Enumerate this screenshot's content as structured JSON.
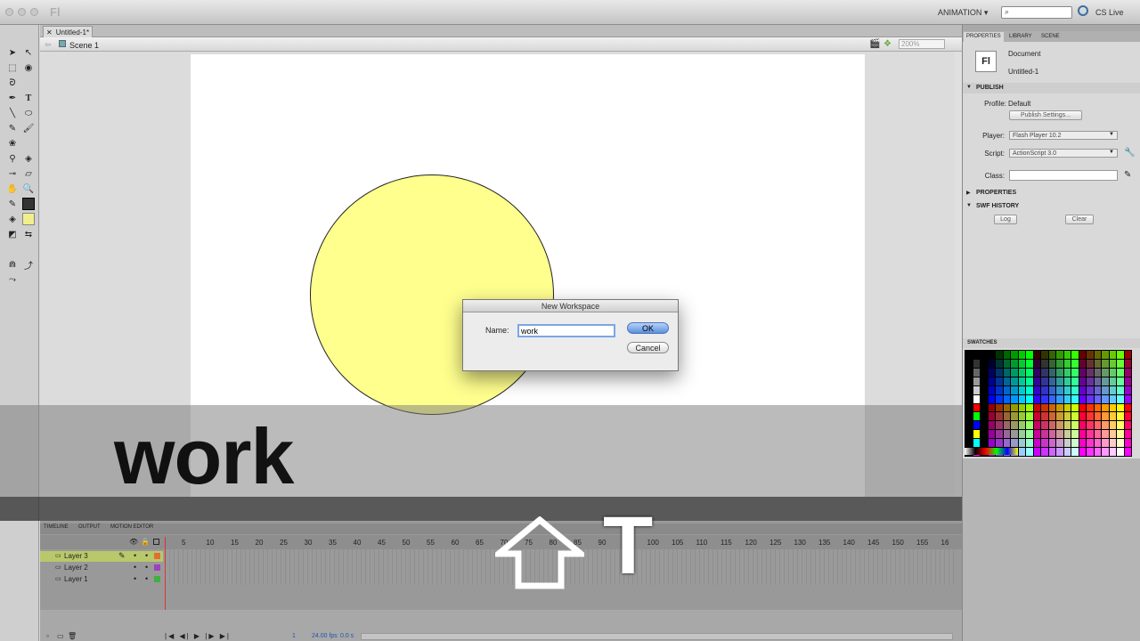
{
  "app": {
    "logo": "Fl",
    "workspace": "ANIMATION ▾",
    "cslive": "CS Live"
  },
  "document": {
    "tab": "Untitled-1*",
    "scene": "Scene 1",
    "zoom": "200%"
  },
  "dialog": {
    "title": "New Workspace",
    "name_label": "Name:",
    "name_value": "work",
    "ok": "OK",
    "cancel": "Cancel"
  },
  "overlay": {
    "typed_word": "work",
    "key": "T"
  },
  "timeline": {
    "tabs": [
      "TIMELINE",
      "OUTPUT",
      "MOTION EDITOR"
    ],
    "frame_numbers": [
      "5",
      "10",
      "15",
      "20",
      "25",
      "30",
      "35",
      "40",
      "45",
      "50",
      "55",
      "60",
      "65",
      "70",
      "75",
      "80",
      "85",
      "90",
      "95",
      "100",
      "105",
      "110",
      "115",
      "120",
      "125",
      "130",
      "135",
      "140",
      "145",
      "150",
      "155",
      "16"
    ],
    "layers": [
      "Layer 3",
      "Layer 2",
      "Layer 1"
    ],
    "current_frame": "1",
    "fps": "24.00 fps",
    "time": "0.0 s"
  },
  "panel": {
    "tabs": [
      "PROPERTIES",
      "LIBRARY",
      "SCENE"
    ],
    "doc_icon": "Fl",
    "doc_type": "Document",
    "doc_name": "Untitled-1",
    "publish_header": "PUBLISH",
    "profile_label": "Profile:",
    "profile_value": "Default",
    "publish_settings": "Publish Settings...",
    "player_label": "Player:",
    "player_value": "Flash Player 10.2",
    "script_label": "Script:",
    "script_value": "ActionScript 3.0",
    "class_label": "Class:",
    "properties_header": "PROPERTIES",
    "swf_header": "SWF HISTORY",
    "log": "Log",
    "clear": "Clear",
    "swatches_header": "SWATCHES"
  },
  "colors": {
    "fill": "#ffff8e",
    "stroke": "#222222",
    "fill_swatch": "#f0ef8a"
  }
}
